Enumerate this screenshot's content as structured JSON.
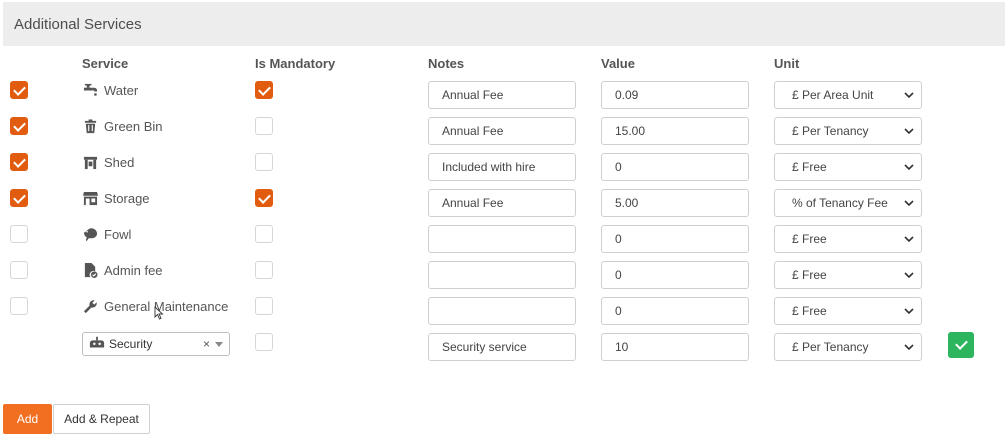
{
  "header": {
    "title": "Additional Services"
  },
  "columns": {
    "service": "Service",
    "mandatory": "Is Mandatory",
    "notes": "Notes",
    "value": "Value",
    "unit": "Unit"
  },
  "rows": [
    {
      "selected": true,
      "icon": "faucet-icon",
      "service": "Water",
      "mandatory": true,
      "notes": "Annual Fee",
      "value": "0.09",
      "unit": "£ Per Area Unit"
    },
    {
      "selected": true,
      "icon": "trash-icon",
      "service": "Green Bin",
      "mandatory": false,
      "notes": "Annual Fee",
      "value": "15.00",
      "unit": "£ Per Tenancy"
    },
    {
      "selected": true,
      "icon": "shed-icon",
      "service": "Shed",
      "mandatory": false,
      "notes": "Included with hire",
      "value": "0",
      "unit": "£ Free"
    },
    {
      "selected": true,
      "icon": "store-icon",
      "service": "Storage",
      "mandatory": true,
      "notes": "Annual Fee",
      "value": "5.00",
      "unit": "% of Tenancy Fee"
    },
    {
      "selected": false,
      "icon": "chicken-icon",
      "service": "Fowl",
      "mandatory": false,
      "notes": "",
      "value": "0",
      "unit": "£ Free"
    },
    {
      "selected": false,
      "icon": "file-check-icon",
      "service": "Admin fee",
      "mandatory": false,
      "notes": "",
      "value": "0",
      "unit": "£ Free"
    },
    {
      "selected": false,
      "icon": "wrench-icon",
      "service": "General Maintenance",
      "mandatory": false,
      "notes": "",
      "value": "0",
      "unit": "£ Free"
    }
  ],
  "new_row": {
    "icon": "robot-icon",
    "service": "Security",
    "clear": "×",
    "mandatory": false,
    "notes": "Security service",
    "value": "10",
    "unit": "£ Per Tenancy"
  },
  "buttons": {
    "add": "Add",
    "add_repeat": "Add & Repeat"
  },
  "colors": {
    "accent": "#e25c10",
    "add_button": "#f26f21",
    "confirm": "#2db55d",
    "header_bg": "#ededed"
  }
}
